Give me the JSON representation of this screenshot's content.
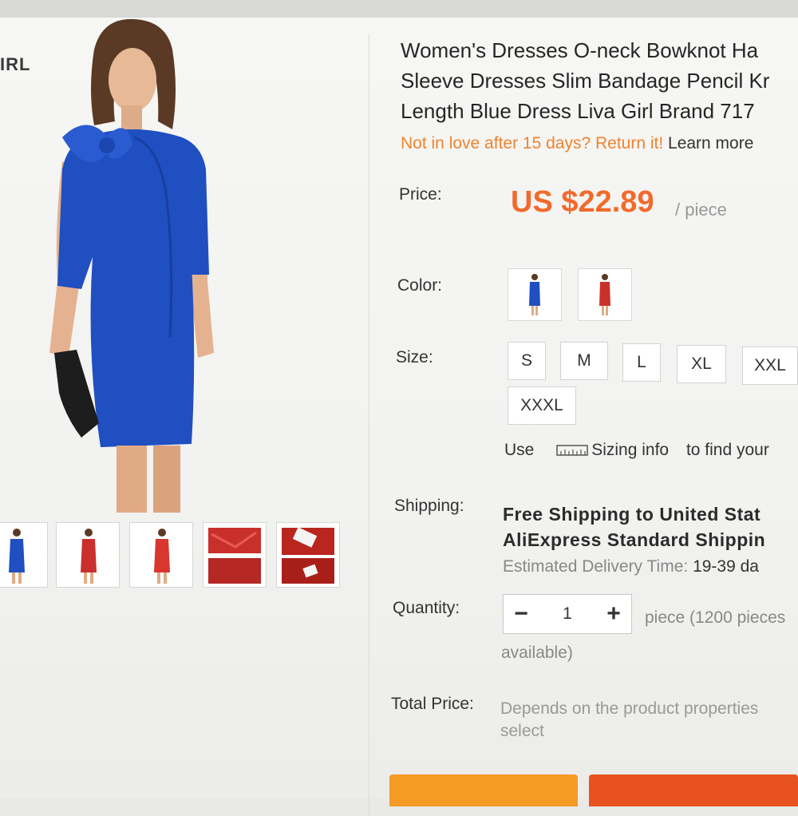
{
  "store": {
    "brand_fragment": "IRL"
  },
  "product": {
    "title_lines": [
      "Women's Dresses O-neck Bowknot Ha",
      "Sleeve Dresses Slim Bandage Pencil Kr",
      "Length Blue Dress Liva Girl Brand 717"
    ],
    "returns_text": "Not in love after 15 days? Return it!",
    "learn_more": "Learn more"
  },
  "price": {
    "label": "Price:",
    "value": "US $22.89",
    "unit": "/ piece"
  },
  "color": {
    "label": "Color:",
    "options": [
      "blue",
      "red"
    ]
  },
  "size": {
    "label": "Size:",
    "options": [
      "S",
      "M",
      "L",
      "XL",
      "XXL",
      "XXXL"
    ],
    "use_text": "Use",
    "sizing_info": "Sizing info",
    "find_text": "to find your"
  },
  "shipping": {
    "label": "Shipping:",
    "line1": "Free Shipping to United Stat",
    "line2": "AliExpress Standard Shippin",
    "estimate_label": "Estimated Delivery Time:",
    "estimate_value": "19-39 da"
  },
  "quantity": {
    "label": "Quantity:",
    "minus": "−",
    "value": "1",
    "plus": "+",
    "available_line1": "piece (1200 pieces",
    "available_line2": "available)"
  },
  "total": {
    "label": "Total Price:",
    "line1": "Depends on the product properties",
    "line2": "select"
  },
  "colors": {
    "accent": "#f26a2c",
    "returns": "#f0832d",
    "dress_blue": "#1f4fc0",
    "dress_red": "#c9302c",
    "buy_button": "#f59a23",
    "cart_button": "#e8521e"
  }
}
